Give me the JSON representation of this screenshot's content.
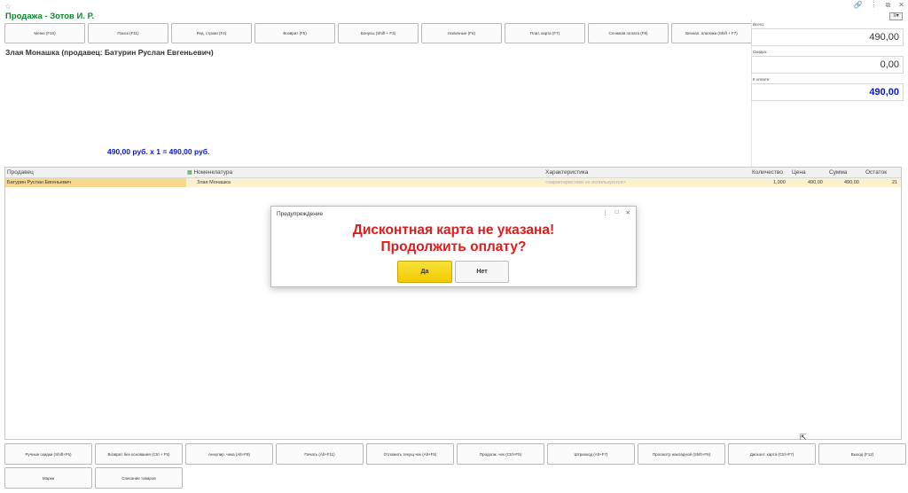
{
  "window": {
    "star_glyph": "☆",
    "controls": [
      "🔗",
      "⋮",
      "⧉",
      "✕"
    ],
    "title": "Продажа - Зотов И. Р.",
    "menu_glyph": "≡▾"
  },
  "toolbar": {
    "buttons": [
      "Меню (F10)",
      "Поиск (F11)",
      "Ред. строки (F4)",
      "Возврат (F5)",
      "Бонусы (Shift + F3)",
      "Наличные (F6)",
      "Плат. карта (F7)",
      "Сложная оплата (F8)",
      "Безнал. платежи (Shift + F7)"
    ]
  },
  "current_item": {
    "product_line": "Злая Монашка (продавец: Батурин Руслан Евгеньевич)",
    "calc_line": "490,00 руб. х 1  = 490,00 руб."
  },
  "totals": {
    "total_label": "Всего:",
    "total_value": "490,00",
    "discount_label": "Скидка:",
    "discount_value": "0,00",
    "to_pay_label": "К оплате:",
    "to_pay_value": "490,00"
  },
  "table": {
    "columns": [
      "Продавец",
      "Номенклатура",
      "Характеристика",
      "Количество",
      "Цена",
      "Сумма",
      "Остаток"
    ],
    "grid_icon": "▦",
    "rows": [
      {
        "seller": "Батурин Руслан Евгеньевич",
        "item": "Злая Монашка",
        "characteristic": "<характеристики не используются>",
        "quantity": "1,000",
        "price": "490,00",
        "sum": "490,00",
        "stock": "21"
      }
    ]
  },
  "dialog": {
    "title": "Предупреждение",
    "controls": [
      "⋮",
      "□",
      "✕"
    ],
    "message_line1": "Дисконтная карта не указана!",
    "message_line2": "Продолжить оплату?",
    "yes_label": "Да",
    "no_label": "Нет"
  },
  "cursor_glyph": "⇱",
  "bottom_toolbar": {
    "row1": [
      "Ручные скидки (Shift+F6)",
      "Возврат без основания (Ctrl + F5)",
      "Аннулир. чека (Alt+F8)",
      "Печать (Alt+F11)",
      "Отложить текущ.чек (Alt+F5)",
      "Продолж. чек (Ctrl+F5)",
      "Штрихкод (Alt+F7)",
      "Просмотр накладной (Shift+F6)",
      "Дисконт. карта (Ctrl+F7)",
      "Выход (F12)"
    ],
    "row2": [
      "Марки",
      "Списание товаров"
    ]
  },
  "colors": {
    "title_green": "#0a8a2a",
    "accent_blue": "#0a19c8",
    "warning_red": "#e31a1a",
    "yes_yellow": "#f2c900",
    "row_highlight": "#fbf1cf"
  }
}
